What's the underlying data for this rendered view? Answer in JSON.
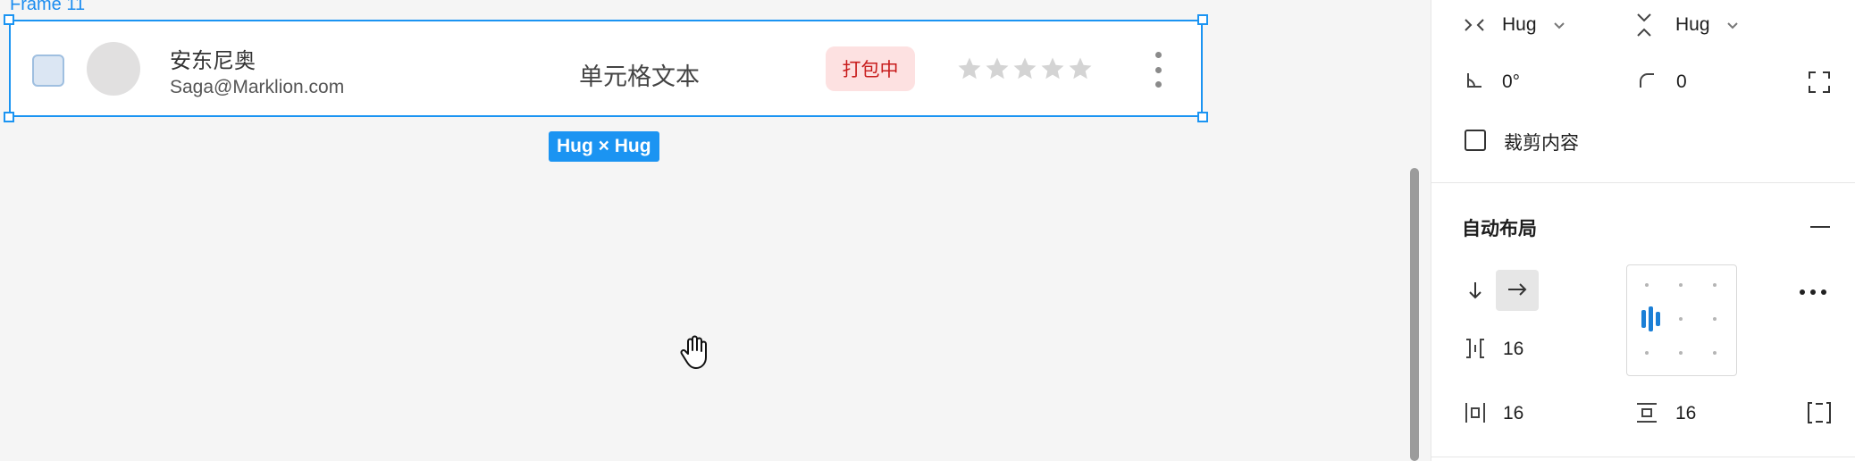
{
  "canvas": {
    "frame_label": "Frame 11",
    "row": {
      "name": "安东尼奥",
      "email": "Saga@Marklion.com",
      "cell_text": "单元格文本",
      "tag_label": "打包中",
      "rating_stars": 5,
      "rating_value": 0
    },
    "size_badge": "Hug × Hug"
  },
  "panel": {
    "width_mode": "Hug",
    "height_mode": "Hug",
    "rotation": "0°",
    "corner_radius": "0",
    "clip_content_label": "裁剪内容",
    "auto_layout": {
      "title": "自动布局",
      "gap": "16",
      "padding_horizontal": "16",
      "padding_vertical": "16"
    }
  },
  "colors": {
    "selection": "#1b94f2",
    "tag_bg": "#fde1e1",
    "tag_text": "#c81d1d",
    "star": "#d4d4d4"
  }
}
